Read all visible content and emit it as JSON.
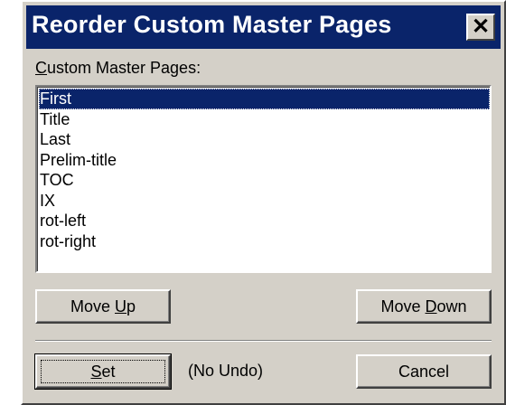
{
  "dialog": {
    "title": "Reorder Custom Master Pages",
    "close_glyph": "✕"
  },
  "list": {
    "label_accel": "C",
    "label_rest": "ustom Master Pages:",
    "items": [
      "First",
      "Title",
      "Last",
      "Prelim-title",
      "TOC",
      "IX",
      "rot-left",
      "rot-right"
    ],
    "selected_index": 0
  },
  "buttons": {
    "move_up_pre": "Move ",
    "move_up_accel": "U",
    "move_up_post": "p",
    "move_down_pre": "Move ",
    "move_down_accel": "D",
    "move_down_post": "own",
    "set_accel": "S",
    "set_post": "et",
    "cancel": "Cancel"
  },
  "no_undo_text": "(No Undo)",
  "colors": {
    "face": "#d4d0c8",
    "titlebar": "#0a246a",
    "selection": "#0a246a"
  }
}
